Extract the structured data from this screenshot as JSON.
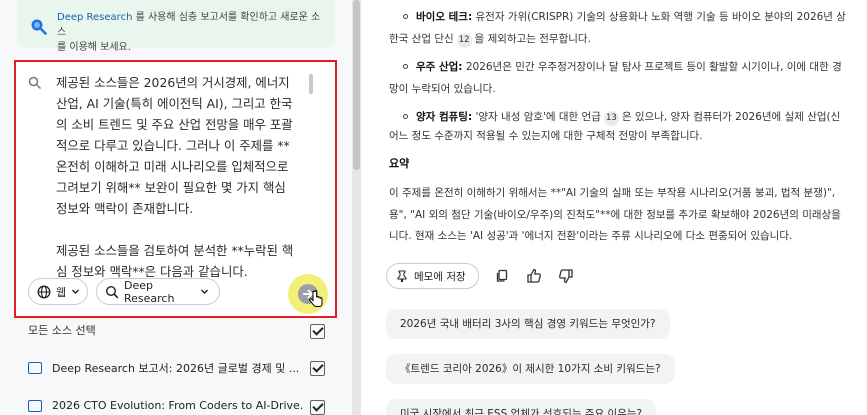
{
  "tip": {
    "brand": "Deep Research",
    "text_1": " 를 사용해 심층 보고서를 확인하고 새로운 소스",
    "text_2": "를 이용해 보세요."
  },
  "compose": {
    "text": "제공된 소스들은 2026년의 거시경제, 에너지\n산업, AI 기술(특히 에이전틱 AI), 그리고 한국\n의 소비 트렌드 및 주요 산업 전망을 매우 포괄\n적으로 다루고 있습니다. 그러나 이 주제를 **\n온전히 이해하고 미래 시나리오를 입체적으로\n그려보기 위해** 보완이 필요한 몇 가지 핵심\n정보와 맥락이 존재합니다.\n\n제공된 소스들을 검토하여 분석한 **누락된 핵\n심 정보와 맥락**은 다음과 같습니다.",
    "web_chip": "웹",
    "deep_research_chip": "Deep Research"
  },
  "sources": {
    "select_all": "모든 소스 선택",
    "items": [
      {
        "title": "Deep Research 보고서: 2026년 글로벌 경제 및 ..."
      },
      {
        "title": "2026 CTO Evolution: From Coders to AI-Drive..."
      }
    ]
  },
  "response": {
    "bio": {
      "label": "바이오 테크:",
      "line1": " 유전자 가위(CRISPR) 기술의 상용화나 노화 역행 기술 등 바이오 분야의 2026년 상",
      "line2a": "한국 산업 단신",
      "cite": "12",
      "line2b": "을 제외하고는 전무합니다."
    },
    "space": {
      "label": "우주 산업:",
      "line1": " 2026년은 민간 우주정거장이나 달 탐사 프로젝트 등이 활발할 시기이나, 이에 대한 경",
      "line2": "망이 누락되어 있습니다."
    },
    "quantum": {
      "label": "양자 컴퓨팅:",
      "line1a": " '양자 내성 암호'에 대한 언급",
      "cite": "13",
      "line1b": "은 있으나, 양자 컴퓨터가 2026년에 실제 산업(신",
      "line2": "어느 정도 수준까지 적용될 수 있는지에 대한 구체적 전망이 부족합니다."
    },
    "summary_title": "요약",
    "summary_lines": [
      "이 주제를 온전히 이해하기 위해서는 **\"AI 기술의 실패 또는 부작용 시나리오(거품 붕괴, 법적 분쟁)\",",
      "용\", \"AI 외의 첨단 기술(바이오/우주)의 진척도\"**에 대한 정보를 추가로 확보해야 2026년의 미래상을",
      "니다. 현재 소스는 'AI 성공'과 '에너지 전환'이라는 주류 시나리오에 다소 편중되어 있습니다."
    ],
    "save_memo": "메모에 저장"
  },
  "suggestions": [
    "2026년 국내 배터리 3사의 핵심 경영 키워드는 무엇인가?",
    "《트렌드 코리아 2026》이 제시한 10가지 소비 키워드는?",
    "미국 시장에서 최근 ESS 업체가 선호되는 주요 이유는?"
  ],
  "colors": {
    "highlight_border": "#e02020",
    "send_highlight": "#f2f07a",
    "tip_background": "#e9f6ee",
    "accent_blue": "#1a5fb4"
  }
}
